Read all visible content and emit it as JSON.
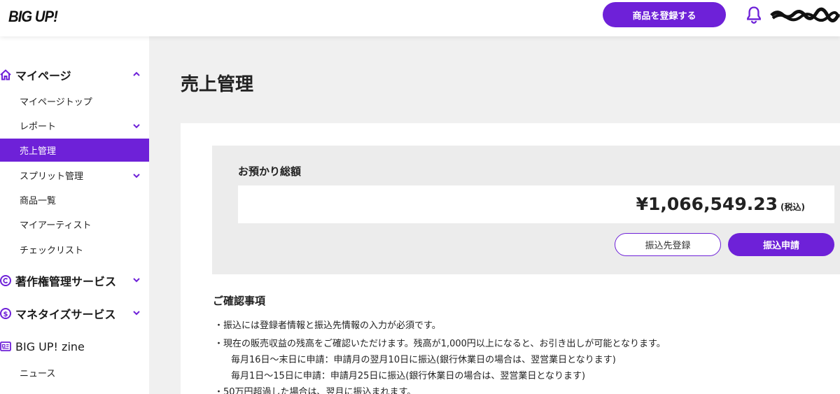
{
  "header": {
    "logo": "BIG UP!",
    "register_button": "商品を登録する"
  },
  "sidebar": {
    "sections": [
      {
        "label": "マイページ",
        "icon": "home-icon",
        "expanded": true
      },
      {
        "label": "著作権管理サービス",
        "icon": "copyright-icon",
        "expanded": false
      },
      {
        "label": "マネタイズサービス",
        "icon": "dollar-icon",
        "expanded": false
      },
      {
        "label": "BIG UP! zine",
        "icon": "newspaper-icon",
        "expanded": false
      }
    ],
    "items": [
      {
        "label": "マイページトップ"
      },
      {
        "label": "レポート"
      },
      {
        "label": "売上管理"
      },
      {
        "label": "スプリット管理"
      },
      {
        "label": "商品一覧"
      },
      {
        "label": "マイアーティスト"
      },
      {
        "label": "チェックリスト"
      },
      {
        "label": "ニュース"
      }
    ],
    "active_item": "売上管理"
  },
  "main": {
    "title": "売上管理",
    "balance": {
      "label": "お預かり総額",
      "amount": "¥1,066,549.23",
      "tax_note": "(税込)"
    },
    "buttons": {
      "register_account": "振込先登録",
      "request_transfer": "振込申請"
    },
    "notes": {
      "title": "ご確認事項",
      "lines": [
        "・振込には登録者情報と振込先情報の入力が必須です。",
        "・現在の販売収益の残高をご確認いただけます。残高が1,000円以上になると、お引き出しが可能となります。",
        "毎月16日〜末日に申請：申請月の翌月10日に振込(銀行休業日の場合は、翌営業日となります)",
        "毎月1日〜15日に申請：申請月25日に振込(銀行休業日の場合は、翌営業日となります)",
        "・50万円超過した場合は、翌月に振込まれます。"
      ]
    }
  },
  "colors": {
    "accent": "#6e21d8",
    "panel": "#ececec",
    "background": "#f0f0f0"
  }
}
